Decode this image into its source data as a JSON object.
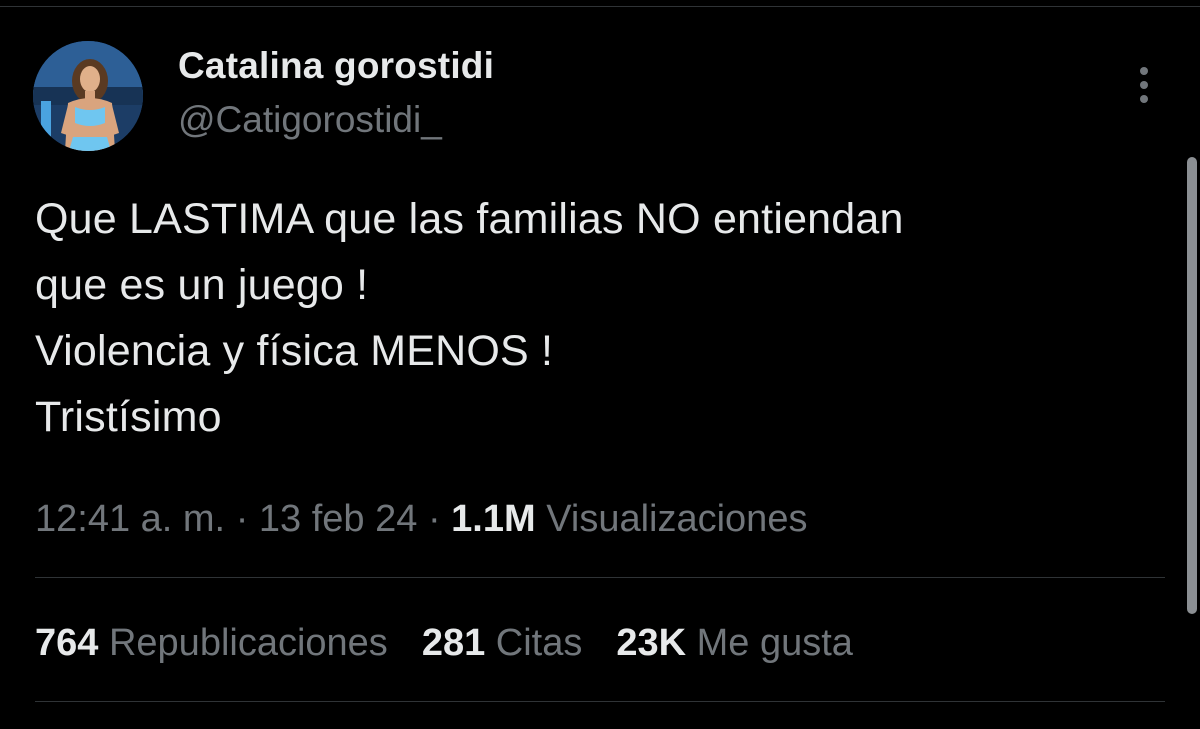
{
  "author": {
    "display_name": "Catalina gorostidi",
    "handle": "@Catigorostidi_"
  },
  "tweet": {
    "lines": [
      "Que LASTIMA que las familias NO entiendan",
      "que es un juego !",
      "Violencia y física MENOS !",
      "Tristísimo"
    ]
  },
  "meta": {
    "time": "12:41 a. m.",
    "separator": "·",
    "date": "13 feb 24",
    "views_count": "1.1M",
    "views_label": "Visualizaciones"
  },
  "stats": {
    "reposts_count": "764",
    "reposts_label": "Republicaciones",
    "quotes_count": "281",
    "quotes_label": "Citas",
    "likes_count": "23K",
    "likes_label": "Me gusta"
  },
  "icons": {
    "more": "more-vertical-icon"
  },
  "colors": {
    "background": "#000000",
    "primary_text": "#e7e9ea",
    "secondary_text": "#71767b",
    "divider": "#2f3336"
  }
}
